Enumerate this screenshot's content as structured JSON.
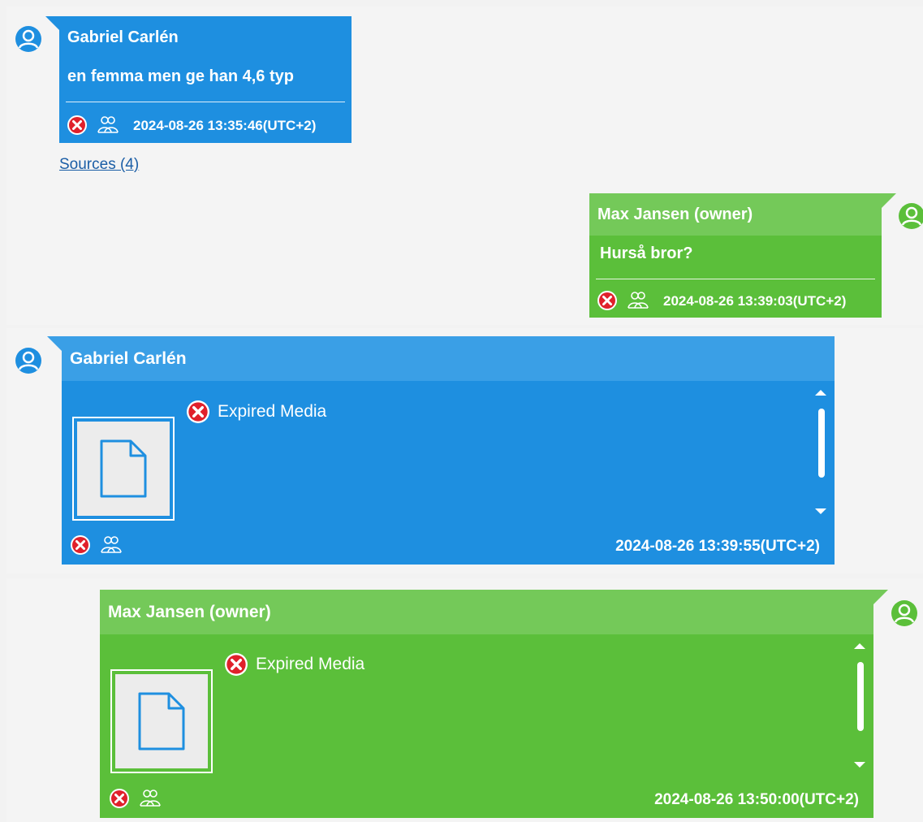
{
  "messages": [
    {
      "sender": "Gabriel Carlén",
      "text": "en femma men ge han 4,6 typ",
      "timestamp": "2024-08-26 13:35:46(UTC+2)",
      "sources_link": "Sources (4)"
    },
    {
      "sender": "Max Jansen (owner)",
      "text": "Hurså bror?",
      "timestamp": "2024-08-26 13:39:03(UTC+2)"
    },
    {
      "sender": "Gabriel Carlén",
      "media_status": "Expired Media",
      "timestamp": "2024-08-26 13:39:55(UTC+2)"
    },
    {
      "sender": "Max Jansen (owner)",
      "media_status": "Expired Media",
      "timestamp": "2024-08-26 13:50:00(UTC+2)"
    }
  ],
  "icons": {
    "avatar": "user-avatar-icon",
    "status": "red-x-icon",
    "participants": "group-icon",
    "file": "file-icon"
  },
  "colors": {
    "blue_bubble": "#1e8fe0",
    "blue_header": "#3a9fe6",
    "green_bubble": "#5bbf3a",
    "green_header": "#74c959",
    "status_red": "#e0202b"
  }
}
